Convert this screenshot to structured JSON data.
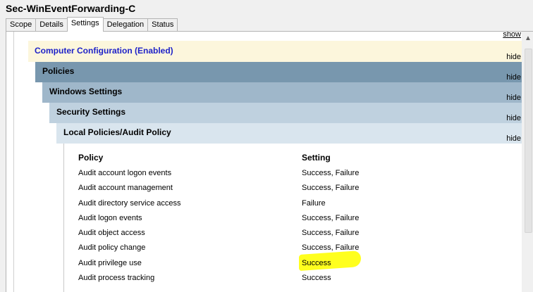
{
  "window": {
    "title": "Sec-WinEventForwarding-C"
  },
  "tabs": [
    {
      "label": "Scope",
      "active": false
    },
    {
      "label": "Details",
      "active": false
    },
    {
      "label": "Settings",
      "active": true
    },
    {
      "label": "Delegation",
      "active": false
    },
    {
      "label": "Status",
      "active": false
    }
  ],
  "report": {
    "top_toggle": "show",
    "computer_config": {
      "label": "Computer Configuration (Enabled)",
      "toggle": "hide"
    },
    "policies": {
      "label": "Policies",
      "toggle": "hide"
    },
    "windows_settings": {
      "label": "Windows Settings",
      "toggle": "hide"
    },
    "security_settings": {
      "label": "Security Settings",
      "toggle": "hide"
    },
    "local_policies": {
      "label": "Local Policies/Audit Policy",
      "toggle": "hide"
    },
    "table": {
      "headers": {
        "policy": "Policy",
        "setting": "Setting"
      },
      "rows": [
        {
          "policy": "Audit account logon events",
          "setting": "Success, Failure"
        },
        {
          "policy": "Audit account management",
          "setting": "Success, Failure"
        },
        {
          "policy": "Audit directory service access",
          "setting": "Failure"
        },
        {
          "policy": "Audit logon events",
          "setting": "Success, Failure"
        },
        {
          "policy": "Audit object access",
          "setting": "Success, Failure"
        },
        {
          "policy": "Audit policy change",
          "setting": "Success, Failure"
        },
        {
          "policy": "Audit privilege use",
          "setting": "Success"
        },
        {
          "policy": "Audit process tracking",
          "setting": "Success"
        }
      ]
    }
  },
  "colors": {
    "computer_config_bg": "#fcf6dc",
    "computer_config_text": "#1e22c8",
    "policies_bg": "#7897ae",
    "windows_settings_bg": "#9fb7ca",
    "security_settings_bg": "#bfd1df",
    "local_policies_bg": "#d9e5ee",
    "highlight": "#ffff1e"
  }
}
